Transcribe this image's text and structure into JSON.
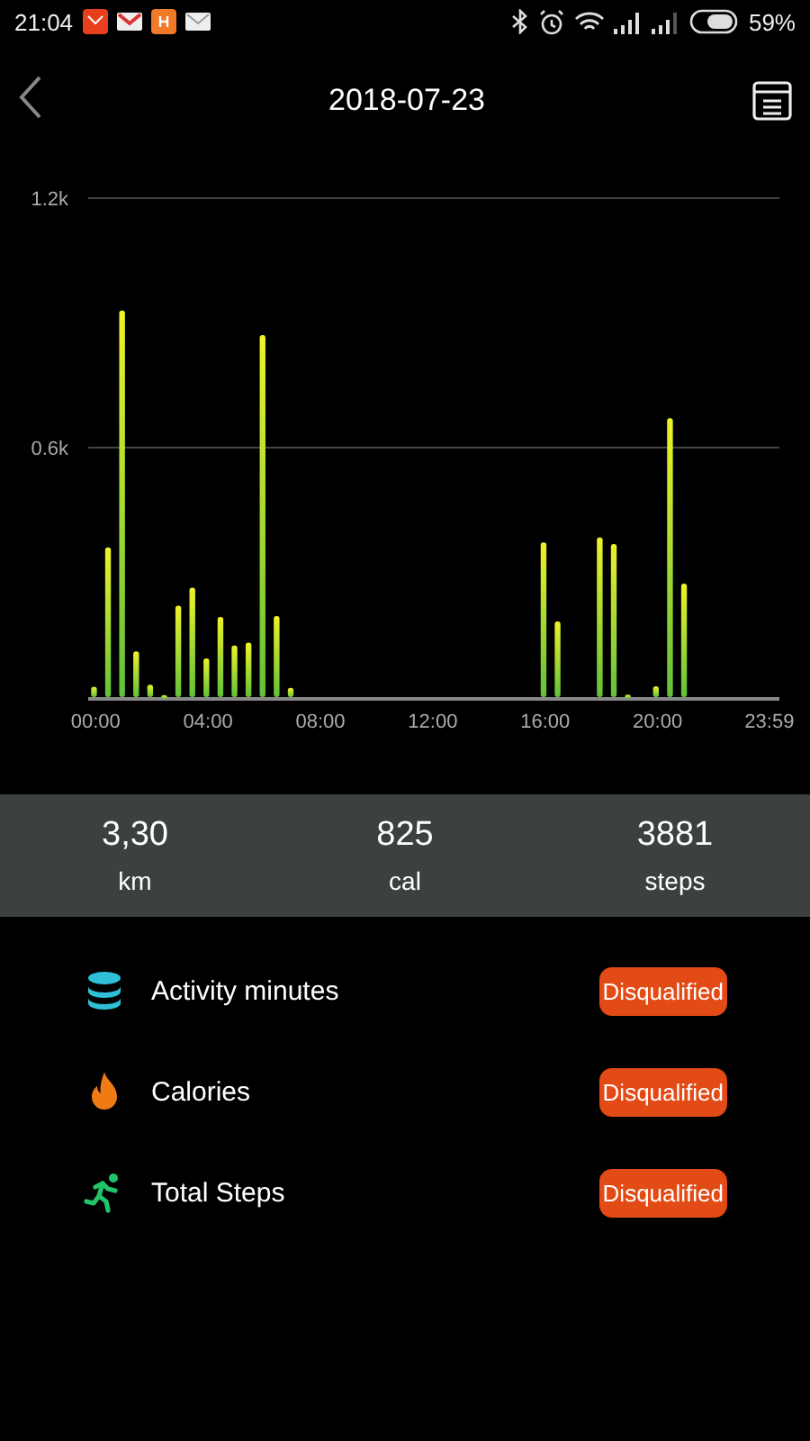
{
  "status_bar": {
    "time": "21:04",
    "battery": "59%"
  },
  "header": {
    "title": "2018-07-23"
  },
  "chart_data": {
    "type": "bar",
    "x": [
      0,
      0.5,
      1,
      1.5,
      2,
      2.5,
      3,
      3.5,
      4,
      4.5,
      5,
      5.5,
      6,
      6.5,
      7,
      16,
      16.5,
      18,
      18.5,
      19,
      20,
      20.5,
      21
    ],
    "series": [
      {
        "color": "#eef22a",
        "values": [
          25,
          360,
          930,
          110,
          30,
          5,
          220,
          263,
          93,
          193,
          124,
          131,
          871,
          195,
          22,
          372,
          182,
          384,
          368,
          6,
          26,
          671,
          273
        ]
      }
    ],
    "xlim": [
      -0.2,
      24.4
    ],
    "ylim": [
      0,
      1200
    ],
    "yticks": [
      {
        "value": 600,
        "label": "0.6k"
      },
      {
        "value": 1200,
        "label": "1.2k"
      }
    ],
    "xticks": [
      {
        "value": 0,
        "label": "00:00"
      },
      {
        "value": 4,
        "label": "04:00"
      },
      {
        "value": 8,
        "label": "08:00"
      },
      {
        "value": 12,
        "label": "12:00"
      },
      {
        "value": 16,
        "label": "16:00"
      },
      {
        "value": 20,
        "label": "20:00"
      },
      {
        "value": 23.98,
        "label": "23:59"
      }
    ]
  },
  "summary": [
    {
      "value": "3,30",
      "unit": "km"
    },
    {
      "value": "825",
      "unit": "cal"
    },
    {
      "value": "3881",
      "unit": "steps"
    }
  ],
  "goals": [
    {
      "kind": "minutes",
      "label": "Activity minutes",
      "status": "Disqualified"
    },
    {
      "kind": "calories",
      "label": "Calories",
      "status": "Disqualified"
    },
    {
      "kind": "steps",
      "label": "Total Steps",
      "status": "Disqualified"
    }
  ]
}
